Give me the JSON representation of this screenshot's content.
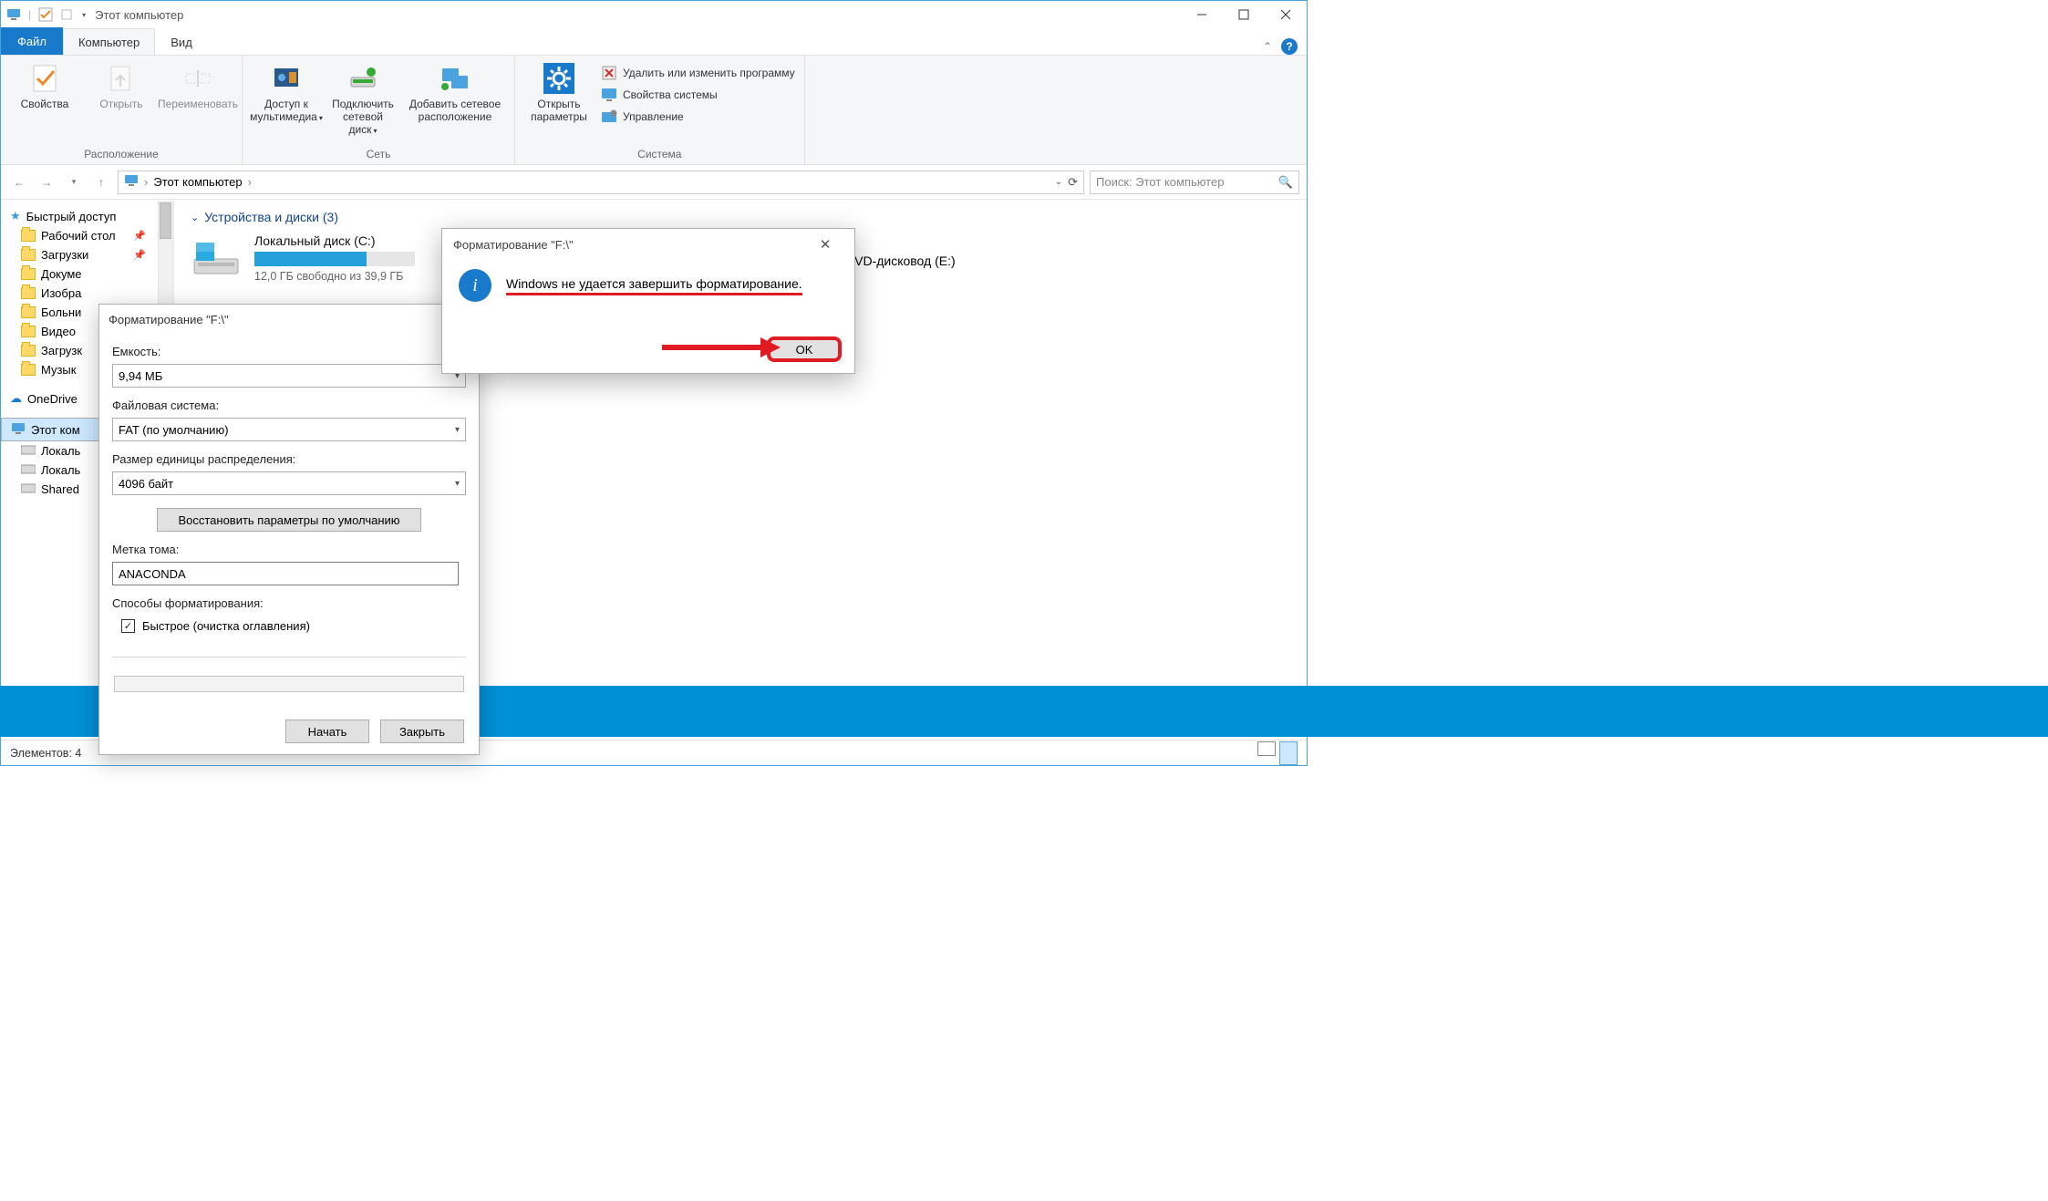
{
  "titlebar": {
    "title": "Этот компьютер"
  },
  "tabs": {
    "file": "Файл",
    "computer": "Компьютер",
    "view": "Вид"
  },
  "ribbon": {
    "group_location": "Расположение",
    "group_network": "Сеть",
    "group_system": "Система",
    "properties": "Свойства",
    "open": "Открыть",
    "rename": "Переименовать",
    "media_access_1": "Доступ к",
    "media_access_2": "мультимедиа",
    "map_drive_1": "Подключить",
    "map_drive_2": "сетевой диск",
    "add_net_1": "Добавить сетевое",
    "add_net_2": "расположение",
    "open_settings_1": "Открыть",
    "open_settings_2": "параметры",
    "uninstall": "Удалить или изменить программу",
    "sys_props": "Свойства системы",
    "manage": "Управление"
  },
  "address": {
    "root": "Этот компьютер",
    "search_placeholder": "Поиск: Этот компьютер"
  },
  "tree": {
    "quick_access": "Быстрый доступ",
    "desktop": "Рабочий стол",
    "downloads": "Загрузки",
    "documents": "Докуме",
    "images": "Изобра",
    "bolni": "Больни",
    "video": "Видео",
    "downloads2": "Загрузк",
    "music": "Музык",
    "onedrive": "OneDrive",
    "this_pc": "Этот ком",
    "local1": "Локаль",
    "local2": "Локаль",
    "shared": "Shared"
  },
  "content": {
    "section": "Устройства и диски (3)",
    "drive_c_name": "Локальный диск (C:)",
    "drive_c_free": "12,0 ГБ свободно из 39,9 ГБ",
    "drive_e_name": "DVD-дисковод (E:)"
  },
  "status": {
    "items": "Элементов: 4"
  },
  "format_dialog": {
    "title": "Форматирование \"F:\\\"",
    "capacity_label": "Емкость:",
    "capacity_value": "9,94 МБ",
    "fs_label": "Файловая система:",
    "fs_value": "FAT (по умолчанию)",
    "alloc_label": "Размер единицы распределения:",
    "alloc_value": "4096 байт",
    "restore_defaults": "Восстановить параметры по умолчанию",
    "volume_label": "Метка тома:",
    "volume_value": "ANACONDA",
    "options_label": "Способы форматирования:",
    "quick_format": "Быстрое (очистка оглавления)",
    "start": "Начать",
    "close": "Закрыть"
  },
  "msgbox": {
    "title": "Форматирование \"F:\\\"",
    "text": "Windows не удается завершить форматирование.",
    "ok": "OK"
  }
}
